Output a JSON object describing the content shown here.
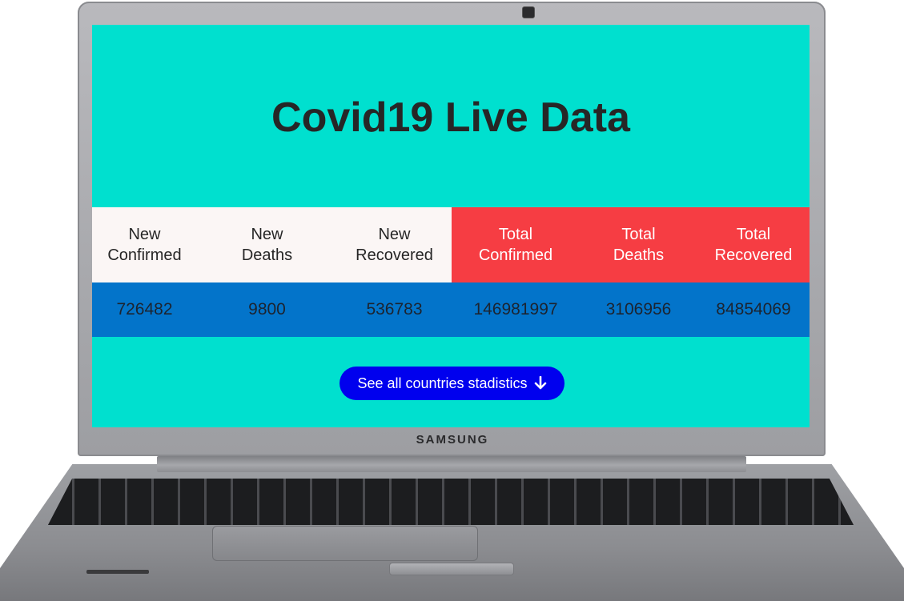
{
  "device": {
    "brand": "SAMSUNG"
  },
  "page": {
    "title": "Covid19 Live Data",
    "headers": {
      "new_confirmed": [
        "New",
        "Confirmed"
      ],
      "new_deaths": [
        "New",
        "Deaths"
      ],
      "new_recovered": [
        "New",
        "Recovered"
      ],
      "total_confirmed": [
        "Total",
        "Confirmed"
      ],
      "total_deaths": [
        "Total",
        "Deaths"
      ],
      "total_recovered": [
        "Total",
        "Recovered"
      ]
    },
    "values": {
      "new_confirmed": "726482",
      "new_deaths": "9800",
      "new_recovered": "536783",
      "total_confirmed": "146981997",
      "total_deaths": "3106956",
      "total_recovered": "84854069"
    },
    "cta": {
      "label": "See all countries stadistics",
      "icon": "arrow-down-icon"
    }
  },
  "colors": {
    "background": "#00e0cf",
    "new_header_bg": "#fbf6f5",
    "total_header_bg": "#f63d43",
    "values_bg": "#0374ca",
    "button_bg": "#0000ee"
  }
}
